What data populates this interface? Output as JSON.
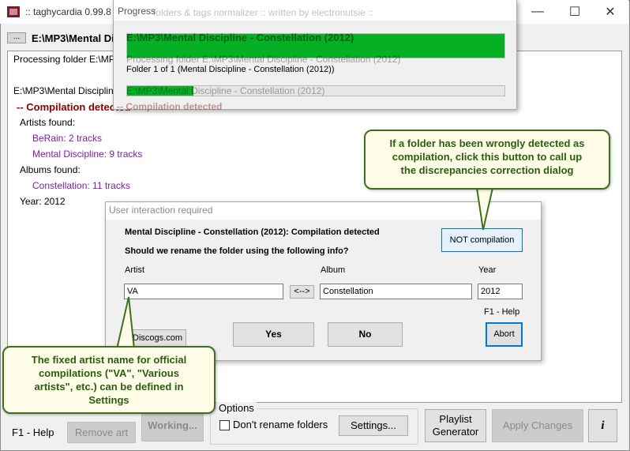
{
  "window": {
    "title": ":: taghycardia 0.99.8 p",
    "overlay_title_fragment": "folders & tags normalizer :: written by electronutsie ::",
    "minimize": "—",
    "maximize": "☐",
    "close": "✕"
  },
  "path_bar": {
    "button": "...",
    "path": "E:\\MP3\\Mental Discipline - Constellation (2012)"
  },
  "log": {
    "line1": "Processing folder E:\\MP3\\Mental Discipline - Constellation (2012)",
    "line2": "E:\\MP3\\Mental Discipline - Constellation (2012)",
    "line3": "-- Compilation detected",
    "line4": "Artists found:",
    "line5": "BeRain: 2 tracks",
    "line6": "Mental Discipline: 9 tracks",
    "line7": "Albums found:",
    "line8": "Constellation: 11 tracks",
    "line9": "Year: 2012"
  },
  "progress": {
    "title": "Progress",
    "folder_caption": "Folder 1 of 1 (Mental Discipline - Constellation (2012))",
    "overall_fraction": 1.0,
    "current_fraction": 0.175
  },
  "dialog": {
    "title": "User interaction required",
    "heading": "Mental Discipline - Constellation (2012): Compilation detected",
    "question": "Should we rename the folder using the following info?",
    "not_compilation": "NOT compilation",
    "artist_label": "Artist",
    "artist_value": "VA",
    "swap": "<-->",
    "album_label": "Album",
    "album_value": "Constellation",
    "year_label": "Year",
    "year_value": "2012",
    "help": "F1 - Help",
    "discogs": "Discogs.com",
    "yes": "Yes",
    "no": "No",
    "abort": "Abort"
  },
  "bottom": {
    "help": "F1 - Help",
    "remove_art": "Remove art",
    "working": "Working...",
    "options_label": "Options",
    "dont_rename": "Don't rename folders",
    "settings": "Settings...",
    "playlist_line1": "Playlist",
    "playlist_line2": "Generator",
    "apply_changes": "Apply Changes",
    "info": "i"
  },
  "callouts": {
    "top_line1": "If a folder has been wrongly detected as",
    "top_line2": "compilation, click this button to call up",
    "top_line3": "the discrepancies correction dialog",
    "bottom_line1": "The fixed artist name for official",
    "bottom_line2": "compilations (\"VA\", \"Various",
    "bottom_line3": "artists\", etc.) can be defined in",
    "bottom_line4": "Settings"
  },
  "colors": {
    "progress_green": "#06b025",
    "compilation_red": "#8b0000",
    "purple_text": "#7b1fa2",
    "callout_green": "#2a5d10"
  }
}
